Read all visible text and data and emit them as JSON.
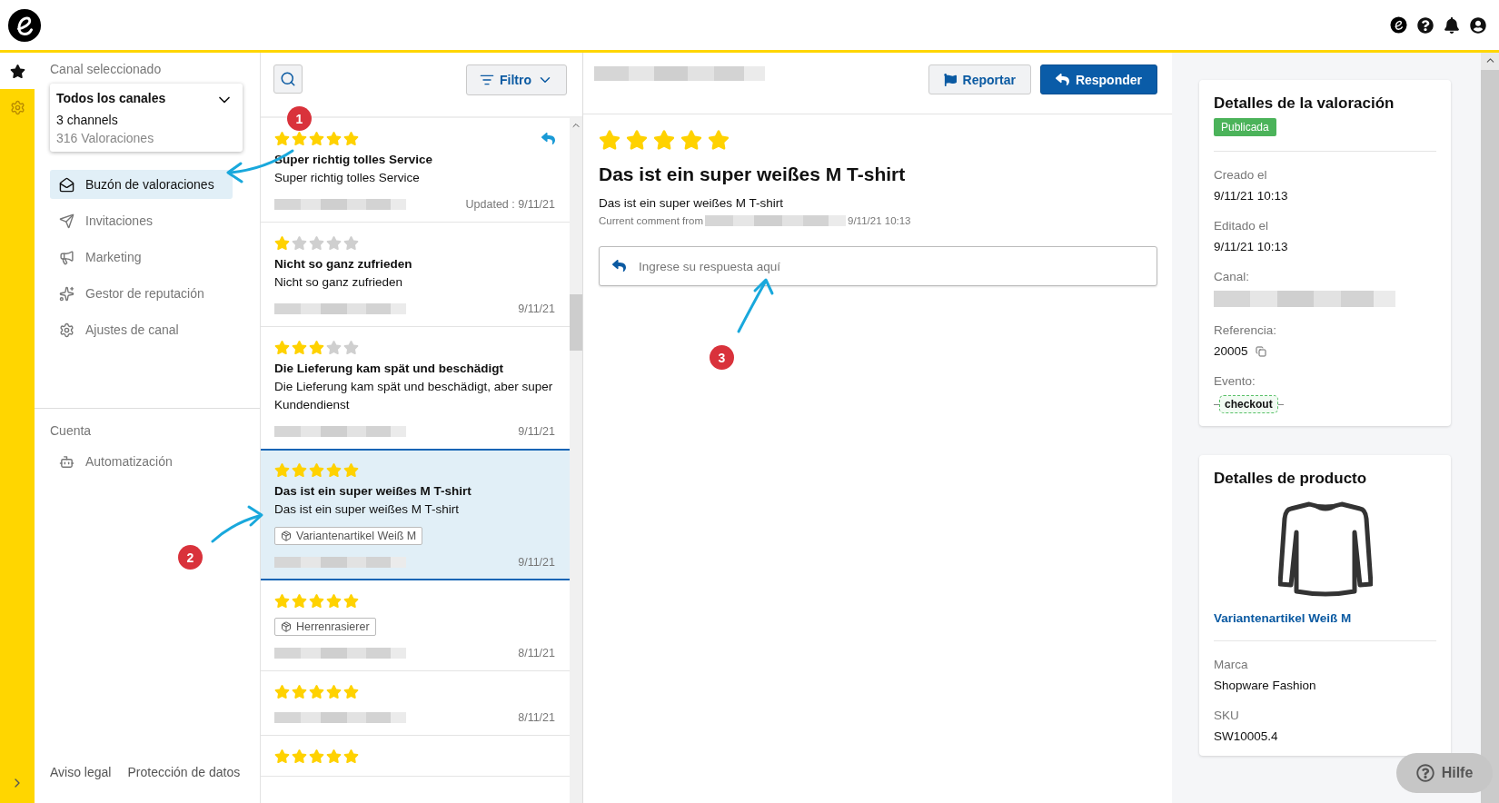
{
  "rail": {
    "items": [
      {
        "kind": "star",
        "selected": true
      },
      {
        "kind": "settings",
        "selected": false
      }
    ]
  },
  "sidebar": {
    "channel_label": "Canal seleccionado",
    "channel_select": {
      "title": "Todos los canales",
      "subtitle": "3 channels",
      "count": "316 Valoraciones"
    },
    "nav": [
      {
        "kind": "inbox",
        "label": "Buzón de valoraciones",
        "selected": true
      },
      {
        "kind": "send",
        "label": "Invitaciones",
        "selected": false
      },
      {
        "kind": "megaphone",
        "label": "Marketing",
        "selected": false
      },
      {
        "kind": "sparkles",
        "label": "Gestor de reputación",
        "selected": false
      },
      {
        "kind": "settings",
        "label": "Ajustes de canal",
        "selected": false
      }
    ],
    "section_title": "Cuenta",
    "account_nav": [
      {
        "kind": "bot",
        "label": "Automatización",
        "selected": false
      }
    ],
    "footer_links": [
      "Aviso legal",
      "Protección de datos"
    ]
  },
  "review_list": {
    "filter_button": "Filtro",
    "reviews": [
      {
        "stars": 5,
        "title": "Super richtig tolles Service",
        "body": "Super richtig tolles Service",
        "date": "Updated : 9/11/21",
        "replied": true,
        "selected": false
      },
      {
        "stars": 1,
        "title": "Nicht so ganz zufrieden",
        "body": "Nicht so ganz zufrieden",
        "date": "9/11/21",
        "replied": false,
        "selected": false
      },
      {
        "stars": 3,
        "title": "Die Lieferung kam spät und beschädigt",
        "body": "Die Lieferung kam spät und beschädigt, aber super Kundendienst",
        "date": "9/11/21",
        "replied": false,
        "selected": false
      },
      {
        "stars": 5,
        "title": "Das ist ein super weißes M T-shirt",
        "body": "Das ist ein super weißes M T-shirt",
        "tag": "Variantenartikel Weiß M",
        "date": "9/11/21",
        "replied": false,
        "selected": true
      },
      {
        "stars": 5,
        "tag": "Herrenrasierer",
        "date": "8/11/21",
        "replied": false,
        "selected": false
      },
      {
        "stars": 5,
        "date": "8/11/21",
        "replied": false,
        "selected": false
      },
      {
        "stars": 5,
        "replied": false,
        "selected": false
      }
    ]
  },
  "review_detail": {
    "report_button": "Reportar",
    "reply_button": "Responder",
    "stars": 5,
    "title": "Das ist ein super weißes M T-shirt",
    "body": "Das ist ein super weißes M T-shirt",
    "meta_prefix": "Current comment from",
    "meta_date": "9/11/21 10:13",
    "reply_placeholder": "Ingrese su respuesta aquí"
  },
  "rating_details": {
    "title": "Detalles de la valoración",
    "status": "Publicada",
    "fields": [
      {
        "kind": "text",
        "label": "Creado el",
        "value": "9/11/21 10:13"
      },
      {
        "kind": "text",
        "label": "Editado el",
        "value": "9/11/21 10:13"
      },
      {
        "kind": "redacted",
        "label": "Canal:"
      },
      {
        "kind": "copy",
        "label": "Referencia:",
        "value": "20005"
      },
      {
        "kind": "event",
        "label": "Evento:",
        "value": "checkout"
      }
    ]
  },
  "product_details": {
    "title": "Detalles de producto",
    "product_link": "Variantenartikel Weiß M",
    "fields": [
      {
        "label": "Marca",
        "value": "Shopware Fashion"
      },
      {
        "label": "SKU",
        "value": "SW10005.4"
      }
    ]
  },
  "help_button": "Hilfe",
  "annotations": [
    {
      "number": "1"
    },
    {
      "number": "2"
    },
    {
      "number": "3"
    }
  ]
}
